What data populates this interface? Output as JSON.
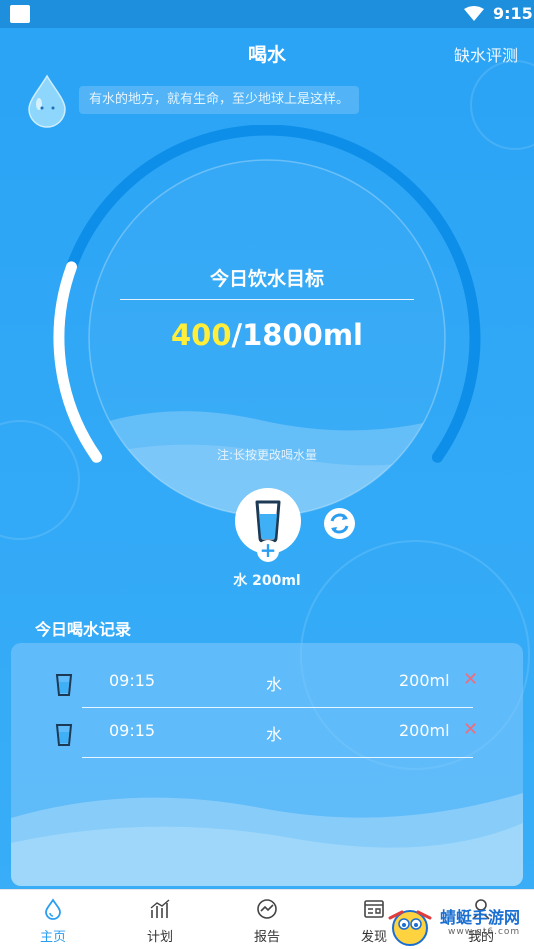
{
  "status_bar": {
    "time": "9:15"
  },
  "header": {
    "title": "喝水",
    "action": "缺水评测"
  },
  "tip": {
    "text": "有水的地方，就有生命，至少地球上是这样。"
  },
  "goal": {
    "label": "今日饮水目标",
    "current": "400",
    "target": "/1800ml",
    "progress": 0.22,
    "hint": "注:长按更改喝水量"
  },
  "drink": {
    "label": "水 200ml"
  },
  "records": {
    "title": "今日喝水记录",
    "items": [
      {
        "time": "09:15",
        "type": "水",
        "amount": "200ml",
        "delete": "✕"
      },
      {
        "time": "09:15",
        "type": "水",
        "amount": "200ml",
        "delete": "✕"
      }
    ]
  },
  "nav": {
    "items": [
      {
        "label": "主页",
        "icon": "home-drop-icon",
        "active": true
      },
      {
        "label": "计划",
        "icon": "plan-chart-icon",
        "active": false
      },
      {
        "label": "报告",
        "icon": "report-icon",
        "active": false
      },
      {
        "label": "发现",
        "icon": "discover-icon",
        "active": false
      },
      {
        "label": "我的",
        "icon": "profile-icon",
        "active": false
      }
    ]
  },
  "watermark": {
    "text": "蜻蜓手游网",
    "url": "www.qt6.com"
  },
  "colors": {
    "accent": "#2b9ef0",
    "highlight": "#ffee3a",
    "ring_track": "#0d8ee8",
    "delete": "#f26b7a"
  }
}
